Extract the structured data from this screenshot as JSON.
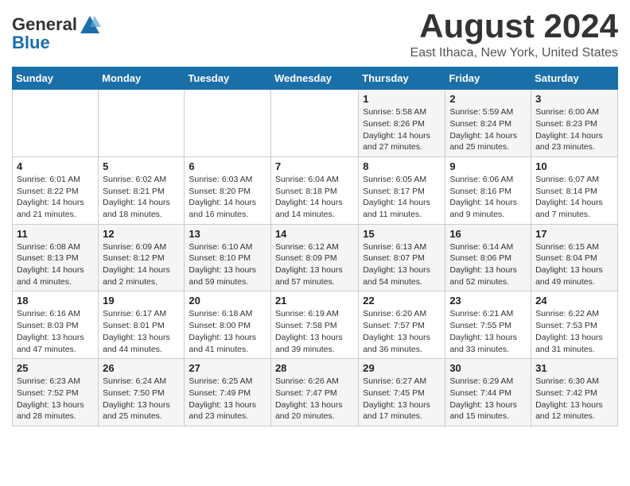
{
  "header": {
    "logo_general": "General",
    "logo_blue": "Blue",
    "month": "August 2024",
    "location": "East Ithaca, New York, United States"
  },
  "weekdays": [
    "Sunday",
    "Monday",
    "Tuesday",
    "Wednesday",
    "Thursday",
    "Friday",
    "Saturday"
  ],
  "weeks": [
    [
      {
        "day": "",
        "info": ""
      },
      {
        "day": "",
        "info": ""
      },
      {
        "day": "",
        "info": ""
      },
      {
        "day": "",
        "info": ""
      },
      {
        "day": "1",
        "info": "Sunrise: 5:58 AM\nSunset: 8:26 PM\nDaylight: 14 hours\nand 27 minutes."
      },
      {
        "day": "2",
        "info": "Sunrise: 5:59 AM\nSunset: 8:24 PM\nDaylight: 14 hours\nand 25 minutes."
      },
      {
        "day": "3",
        "info": "Sunrise: 6:00 AM\nSunset: 8:23 PM\nDaylight: 14 hours\nand 23 minutes."
      }
    ],
    [
      {
        "day": "4",
        "info": "Sunrise: 6:01 AM\nSunset: 8:22 PM\nDaylight: 14 hours\nand 21 minutes."
      },
      {
        "day": "5",
        "info": "Sunrise: 6:02 AM\nSunset: 8:21 PM\nDaylight: 14 hours\nand 18 minutes."
      },
      {
        "day": "6",
        "info": "Sunrise: 6:03 AM\nSunset: 8:20 PM\nDaylight: 14 hours\nand 16 minutes."
      },
      {
        "day": "7",
        "info": "Sunrise: 6:04 AM\nSunset: 8:18 PM\nDaylight: 14 hours\nand 14 minutes."
      },
      {
        "day": "8",
        "info": "Sunrise: 6:05 AM\nSunset: 8:17 PM\nDaylight: 14 hours\nand 11 minutes."
      },
      {
        "day": "9",
        "info": "Sunrise: 6:06 AM\nSunset: 8:16 PM\nDaylight: 14 hours\nand 9 minutes."
      },
      {
        "day": "10",
        "info": "Sunrise: 6:07 AM\nSunset: 8:14 PM\nDaylight: 14 hours\nand 7 minutes."
      }
    ],
    [
      {
        "day": "11",
        "info": "Sunrise: 6:08 AM\nSunset: 8:13 PM\nDaylight: 14 hours\nand 4 minutes."
      },
      {
        "day": "12",
        "info": "Sunrise: 6:09 AM\nSunset: 8:12 PM\nDaylight: 14 hours\nand 2 minutes."
      },
      {
        "day": "13",
        "info": "Sunrise: 6:10 AM\nSunset: 8:10 PM\nDaylight: 13 hours\nand 59 minutes."
      },
      {
        "day": "14",
        "info": "Sunrise: 6:12 AM\nSunset: 8:09 PM\nDaylight: 13 hours\nand 57 minutes."
      },
      {
        "day": "15",
        "info": "Sunrise: 6:13 AM\nSunset: 8:07 PM\nDaylight: 13 hours\nand 54 minutes."
      },
      {
        "day": "16",
        "info": "Sunrise: 6:14 AM\nSunset: 8:06 PM\nDaylight: 13 hours\nand 52 minutes."
      },
      {
        "day": "17",
        "info": "Sunrise: 6:15 AM\nSunset: 8:04 PM\nDaylight: 13 hours\nand 49 minutes."
      }
    ],
    [
      {
        "day": "18",
        "info": "Sunrise: 6:16 AM\nSunset: 8:03 PM\nDaylight: 13 hours\nand 47 minutes."
      },
      {
        "day": "19",
        "info": "Sunrise: 6:17 AM\nSunset: 8:01 PM\nDaylight: 13 hours\nand 44 minutes."
      },
      {
        "day": "20",
        "info": "Sunrise: 6:18 AM\nSunset: 8:00 PM\nDaylight: 13 hours\nand 41 minutes."
      },
      {
        "day": "21",
        "info": "Sunrise: 6:19 AM\nSunset: 7:58 PM\nDaylight: 13 hours\nand 39 minutes."
      },
      {
        "day": "22",
        "info": "Sunrise: 6:20 AM\nSunset: 7:57 PM\nDaylight: 13 hours\nand 36 minutes."
      },
      {
        "day": "23",
        "info": "Sunrise: 6:21 AM\nSunset: 7:55 PM\nDaylight: 13 hours\nand 33 minutes."
      },
      {
        "day": "24",
        "info": "Sunrise: 6:22 AM\nSunset: 7:53 PM\nDaylight: 13 hours\nand 31 minutes."
      }
    ],
    [
      {
        "day": "25",
        "info": "Sunrise: 6:23 AM\nSunset: 7:52 PM\nDaylight: 13 hours\nand 28 minutes."
      },
      {
        "day": "26",
        "info": "Sunrise: 6:24 AM\nSunset: 7:50 PM\nDaylight: 13 hours\nand 25 minutes."
      },
      {
        "day": "27",
        "info": "Sunrise: 6:25 AM\nSunset: 7:49 PM\nDaylight: 13 hours\nand 23 minutes."
      },
      {
        "day": "28",
        "info": "Sunrise: 6:26 AM\nSunset: 7:47 PM\nDaylight: 13 hours\nand 20 minutes."
      },
      {
        "day": "29",
        "info": "Sunrise: 6:27 AM\nSunset: 7:45 PM\nDaylight: 13 hours\nand 17 minutes."
      },
      {
        "day": "30",
        "info": "Sunrise: 6:29 AM\nSunset: 7:44 PM\nDaylight: 13 hours\nand 15 minutes."
      },
      {
        "day": "31",
        "info": "Sunrise: 6:30 AM\nSunset: 7:42 PM\nDaylight: 13 hours\nand 12 minutes."
      }
    ]
  ]
}
